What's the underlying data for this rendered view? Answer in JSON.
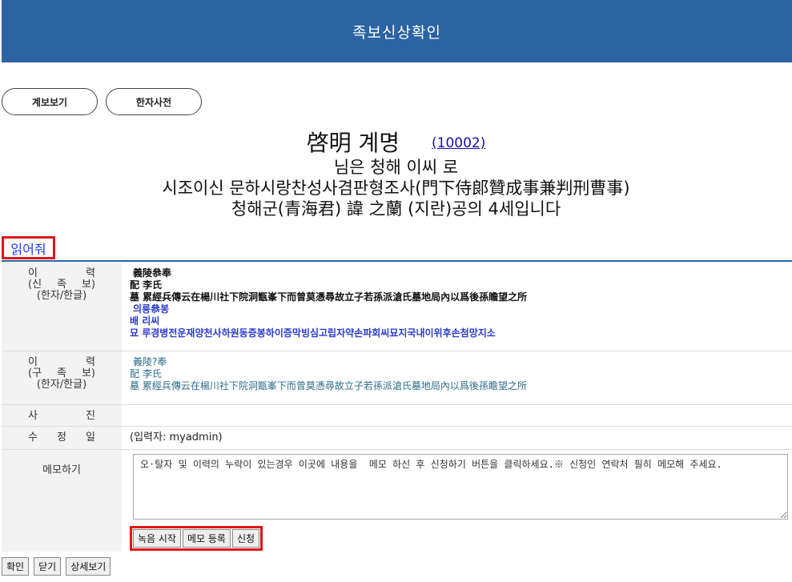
{
  "header": {
    "title": "족보신상확인"
  },
  "nav": {
    "genealogy_view": "계보보기",
    "hanja_dict": "한자사전"
  },
  "headline": {
    "name": "啓明 계명",
    "code": "(10002)",
    "line2": "님은 청해 이씨 로",
    "line3": "시조이신 문하시랑찬성사겸판형조사(門下侍郞贊成事兼判刑曹事)",
    "line4": "청해군(青海君) 諱 之蘭 (지란)공의 4세입니다"
  },
  "read_button": "읽어줘",
  "rows": {
    "new_history": {
      "label_a": [
        "이",
        "력"
      ],
      "label_b": [
        "(신",
        "족",
        "보)"
      ],
      "label_c": "(한자/한글)",
      "lines": [
        "義陵叅奉",
        "配 李氏",
        "墓 累經兵傳云在楊川社下院洞甑峯下而曾莫憑尋故立子若孫派滄氏墓地局內以爲後孫瞻望之所",
        "의릉叅봉",
        "배 리씨",
        "묘 루경병전운재양천사하원동증봉하이증막빙심고립자약손파회씨묘지국내이위후손첨망지소"
      ]
    },
    "old_history": {
      "label_a": [
        "이",
        "력"
      ],
      "label_b": [
        "(구",
        "족",
        "보)"
      ],
      "label_c": "(한자/한글)",
      "lines": [
        "義陵?奉",
        "配 李氏",
        "墓 累經兵傳云在楊川社下院洞甑峯下而曾莫憑尋故立子若孫派滄氏墓地局內以爲後孫瞻望之所"
      ]
    },
    "photo": {
      "label": [
        "사",
        "진"
      ]
    },
    "modified": {
      "label": [
        "수",
        "정",
        "일"
      ],
      "value": "(입력자: myadmin)"
    },
    "memo": {
      "label": "메모하기",
      "text": "오·탈자 및 이력의 누락이 있는경우 이곳에 내용을  메모 하신 후 신청하기 버튼을 클릭하세요.※ 신청인 연락처 필히 메모해 주세요.",
      "record_start": "녹음 시작",
      "memo_register": "메모 등록",
      "apply": "신청"
    }
  },
  "bottom": {
    "confirm": "확인",
    "close": "닫기",
    "detail": "상세보기"
  }
}
